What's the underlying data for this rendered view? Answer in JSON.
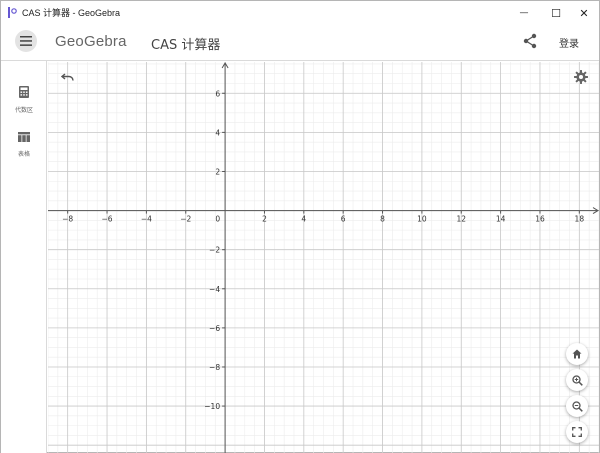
{
  "window": {
    "title": "CAS 计算器 - GeoGebra",
    "minimize_glyph": "—",
    "maximize_glyph": "☐",
    "close_glyph": "✕"
  },
  "header": {
    "brand": "GeoGebra",
    "app_name": "CAS 计算器",
    "login_label": "登录"
  },
  "sidebar": {
    "items": [
      {
        "label": "代数区",
        "icon": "calculator-icon"
      },
      {
        "label": "表格",
        "icon": "table-icon"
      }
    ]
  },
  "graph": {
    "x_range": [
      -9,
      19
    ],
    "y_range": [
      -12.4,
      7.6
    ],
    "x_ticks": [
      -8,
      -6,
      -4,
      -2,
      2,
      4,
      6,
      8,
      10,
      12,
      14,
      16,
      18
    ],
    "y_ticks": [
      6,
      4,
      2,
      -2,
      -4,
      -6,
      -8,
      -10
    ],
    "origin_label": "0",
    "major_step": 2,
    "minor_step": 0.5,
    "grid": true
  },
  "colors": {
    "accent": "#6557d2",
    "axis": "#555555",
    "major_grid": "#c8c8c8",
    "minor_grid": "#ececec",
    "icon": "#666666"
  }
}
